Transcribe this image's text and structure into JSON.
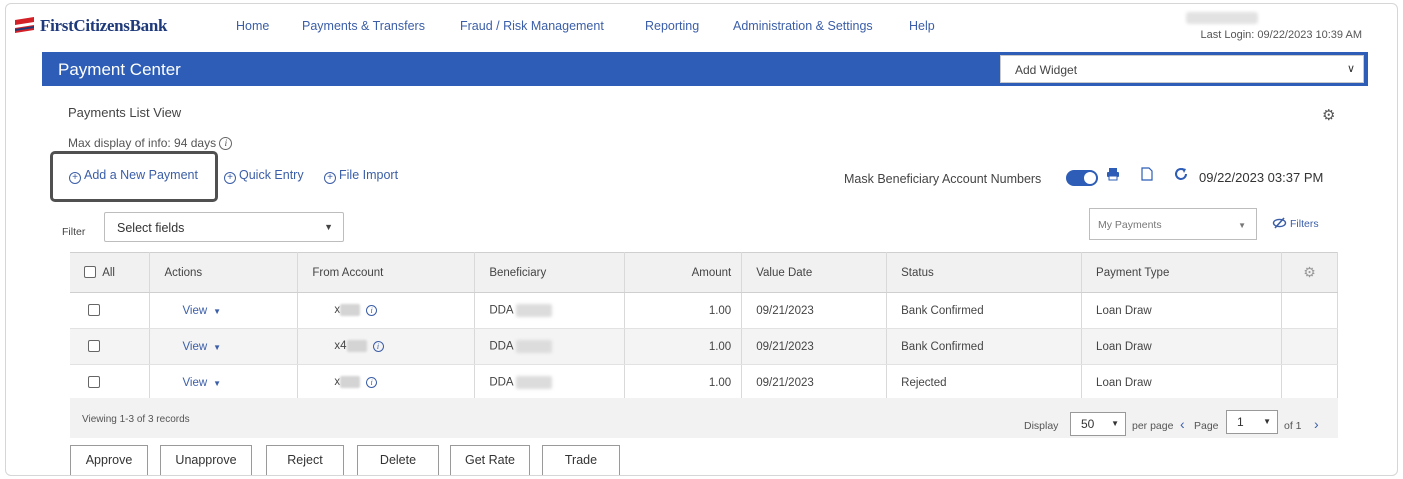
{
  "brand": {
    "name": "FirstCitizensBank"
  },
  "nav": {
    "items": [
      "Home",
      "Payments & Transfers",
      "Fraud / Risk Management",
      "Reporting",
      "Administration & Settings",
      "Help"
    ],
    "last_login": "Last Login: 09/22/2023 10:39 AM"
  },
  "header": {
    "title": "Payment Center",
    "widget_select": "Add Widget"
  },
  "page": {
    "title": "Payments List View",
    "max_display": "Max display of info: 94 days",
    "actions": {
      "add_new": "Add a New Payment",
      "quick_entry": "Quick Entry",
      "file_import": "File Import"
    },
    "mask_label": "Mask Beneficiary Account Numbers",
    "mask_enabled": true,
    "timestamp": "09/22/2023 03:37 PM",
    "filter": {
      "label": "Filter",
      "select": "Select fields",
      "view": "My Payments",
      "filters_link": "Filters"
    }
  },
  "table": {
    "headers": [
      "All",
      "Actions",
      "From Account",
      "Beneficiary",
      "Amount",
      "Value Date",
      "Status",
      "Payment Type"
    ],
    "rows": [
      {
        "action": "View",
        "from": "x",
        "beneficiary": "DDA",
        "amount": "1.00",
        "value_date": "09/21/2023",
        "status": "Bank Confirmed",
        "type": "Loan Draw"
      },
      {
        "action": "View",
        "from": "x4",
        "beneficiary": "DDA",
        "amount": "1.00",
        "value_date": "09/21/2023",
        "status": "Bank Confirmed",
        "type": "Loan Draw"
      },
      {
        "action": "View",
        "from": "x",
        "beneficiary": "DDA",
        "amount": "1.00",
        "value_date": "09/21/2023",
        "status": "Rejected",
        "type": "Loan Draw"
      }
    ]
  },
  "footer": {
    "viewing": "Viewing 1-3 of 3 records",
    "display_label": "Display",
    "per_page_value": "50",
    "per_page_label": "per page",
    "page_label": "Page",
    "page_value": "1",
    "of_label": "of 1"
  },
  "buttons": [
    "Approve",
    "Unapprove",
    "Reject",
    "Delete",
    "Get Rate",
    "Trade"
  ],
  "colors": {
    "brand_blue": "#2d5db6",
    "link_blue": "#3b5ea8",
    "logo_red": "#d42027"
  }
}
